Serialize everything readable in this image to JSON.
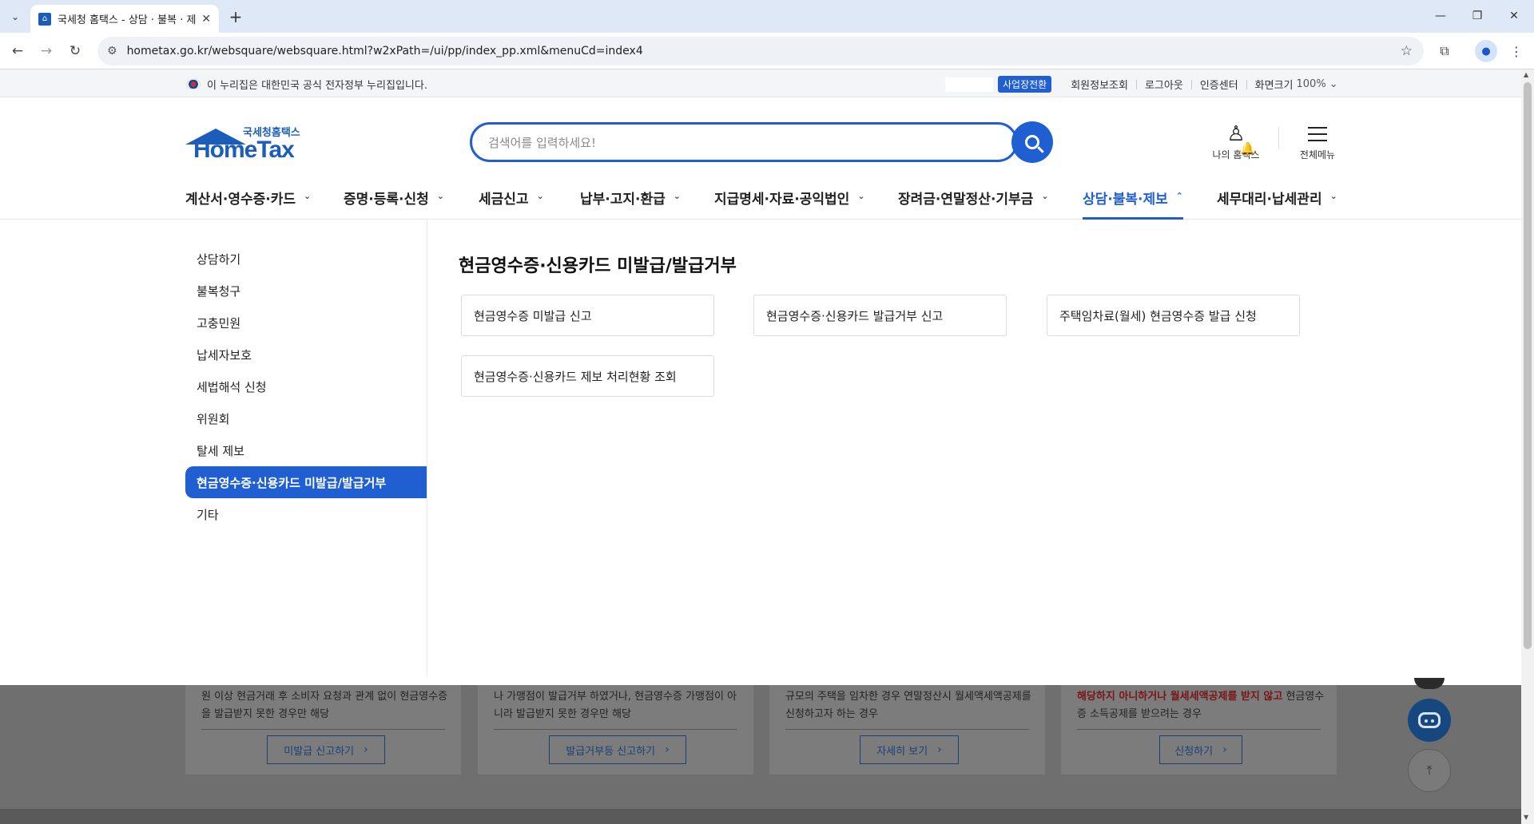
{
  "browser": {
    "tab_title": "국세청 홈택스 - 상담 · 불복 · 제보",
    "url": "hometax.go.kr/websquare/websquare.html?w2xPath=/ui/pp/index_pp.xml&menuCd=index4"
  },
  "gov_notice": "이 누리집은 대한민국 공식 전자정부 누리집입니다.",
  "util": {
    "biz_switch": "사업장전환",
    "member_info": "회원정보조회",
    "logout": "로그아웃",
    "cert_center": "인증센터",
    "screen_size": "화면크기",
    "zoom": "100%"
  },
  "logo": {
    "sub": "국세청홈택스",
    "main": "HomeTax"
  },
  "search": {
    "placeholder": "검색어를 입력하세요!"
  },
  "header": {
    "my_hometax": "나의 홈택스",
    "all_menu": "전체메뉴"
  },
  "gnb": [
    {
      "label": "계산서·영수증·카드"
    },
    {
      "label": "증명·등록·신청"
    },
    {
      "label": "세금신고"
    },
    {
      "label": "납부·고지·환급"
    },
    {
      "label": "지급명세·자료·공익법인"
    },
    {
      "label": "장려금·연말정산·기부금"
    },
    {
      "label": "상담·불복·제보"
    },
    {
      "label": "세무대리·납세관리"
    }
  ],
  "lnb": [
    {
      "label": "상담하기"
    },
    {
      "label": "불복청구"
    },
    {
      "label": "고충민원"
    },
    {
      "label": "납세자보호"
    },
    {
      "label": "세법해석 신청"
    },
    {
      "label": "위원회"
    },
    {
      "label": "탈세 제보"
    },
    {
      "label": "현금영수증·신용카드 미발급/발급거부"
    },
    {
      "label": "기타"
    }
  ],
  "content": {
    "title": "현금영수증·신용카드 미발급/발급거부",
    "cards": [
      {
        "label": "현금영수증 미발급 신고"
      },
      {
        "label": "현금영수증·신용카드 발급거부 신고"
      },
      {
        "label": "주택임차료(월세) 현금영수증 발급 신청"
      },
      {
        "label": "현금영수증·신용카드 제보 처리현황 조회"
      }
    ]
  },
  "background_cards": [
    {
      "text": "원 이상 현금거래 후 소비자 요청과 관계 없이 현금영수증을 발급받지 못한 경우만 해당",
      "button": "미발급 신고하기"
    },
    {
      "text": "나 가맹점이 발급거부 하였거나, 현금영수증 가맹점이 아니라 발급받지 못한 경우만 해당",
      "button": "발급거부등 신고하기"
    },
    {
      "text": "규모의 주택을 임차한 경우 연말정산시 월세액세액공제를 신청하고자 하는 경우",
      "button": "자세히 보기"
    },
    {
      "text_red": "해당하지 아니하거나 월세세액공제를 받지 않고",
      "text_after": " 현금영수증 소득공제를 받으려는 경우",
      "button": "신청하기"
    }
  ],
  "colors": {
    "primary": "#1f5fd1",
    "logo": "#1b5db8"
  }
}
